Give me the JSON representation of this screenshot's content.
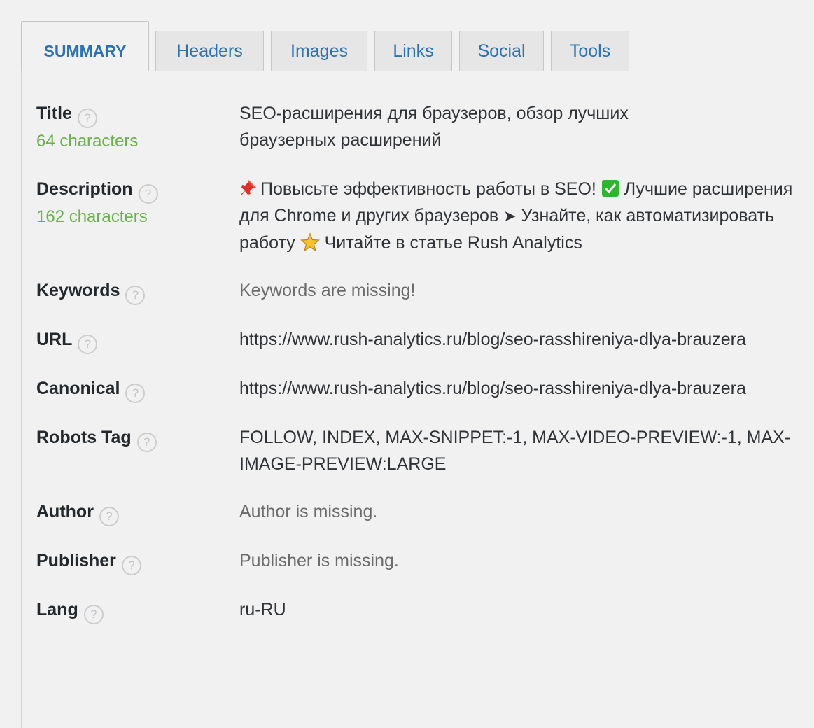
{
  "tabs": [
    {
      "label": "SUMMARY",
      "active": true
    },
    {
      "label": "Headers"
    },
    {
      "label": "Images"
    },
    {
      "label": "Links"
    },
    {
      "label": "Social"
    },
    {
      "label": "Tools"
    }
  ],
  "help_glyph": "?",
  "rows": {
    "title": {
      "label": "Title",
      "count": "64 characters",
      "value": "SEO-расширения для браузеров, обзор лучших браузерных расширений"
    },
    "description": {
      "label": "Description",
      "count": "162 characters",
      "value_part1": "Повысьте эффективность работы в SEO!",
      "value_part2": "Лучшие расширения для Chrome и других браузеров",
      "arrow": "➤",
      "value_part3": "Узнайте, как автоматизировать работу",
      "value_part4": "Читайте в статье Rush Analytics"
    },
    "keywords": {
      "label": "Keywords",
      "value": "Keywords are missing!"
    },
    "url": {
      "label": "URL",
      "value": "https://www.rush-analytics.ru/blog/seo-rasshireniya-dlya-brauzera"
    },
    "canonical": {
      "label": "Canonical",
      "value": "https://www.rush-analytics.ru/blog/seo-rasshireniya-dlya-brauzera"
    },
    "robots": {
      "label": "Robots Tag",
      "value": "FOLLOW, INDEX, MAX-SNIPPET:-1, MAX-VIDEO-PREVIEW:-1, MAX-IMAGE-PREVIEW:LARGE"
    },
    "author": {
      "label": "Author",
      "value": "Author is missing."
    },
    "publisher": {
      "label": "Publisher",
      "value": "Publisher is missing."
    },
    "lang": {
      "label": "Lang",
      "value": "ru-RU"
    }
  },
  "colors": {
    "tab_text": "#2c72b1",
    "count_green": "#6ab04c",
    "missing_gray": "#6b6b6b",
    "background": "#f1f1f1"
  },
  "icons": [
    "help-icon",
    "pushpin-icon",
    "check-mark-icon",
    "arrow-icon",
    "star-icon"
  ]
}
